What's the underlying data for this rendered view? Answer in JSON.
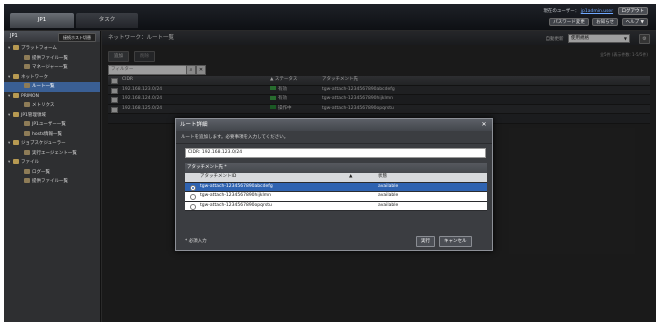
{
  "top_tabs": [
    "JP1",
    "タスク"
  ],
  "user": {
    "prefix": "現在のユーザー：",
    "name": "jp1admin.user",
    "logout": "ログアウト"
  },
  "util_buttons": [
    "パスワード変更",
    "お知らせ",
    "ヘルプ ▼"
  ],
  "sidebar": {
    "title": "JP1",
    "action_button": "接続ホスト切替",
    "items": [
      {
        "label": "プラットフォーム",
        "level": 0,
        "type": "folder"
      },
      {
        "label": "提供ファイル一覧",
        "level": 2,
        "type": "leaf"
      },
      {
        "label": "マネージャー一覧",
        "level": 2,
        "type": "leaf"
      },
      {
        "label": "ネットワーク",
        "level": 0,
        "type": "folder"
      },
      {
        "label": "ルート一覧",
        "level": 2,
        "type": "leaf",
        "selected": true
      },
      {
        "label": "PRIMON",
        "level": 0,
        "type": "folder"
      },
      {
        "label": "メトリクス",
        "level": 2,
        "type": "leaf"
      },
      {
        "label": "JP1管理領域",
        "level": 0,
        "type": "folder"
      },
      {
        "label": "JP1ユーザー一覧",
        "level": 2,
        "type": "leaf"
      },
      {
        "label": "hosts情報一覧",
        "level": 2,
        "type": "leaf"
      },
      {
        "label": "ジョブスケジューラー",
        "level": 0,
        "type": "folder"
      },
      {
        "label": "実行エージェント一覧",
        "level": 2,
        "type": "leaf"
      },
      {
        "label": "ファイル",
        "level": 0,
        "type": "folder"
      },
      {
        "label": "ログ一覧",
        "level": 2,
        "type": "leaf"
      },
      {
        "label": "提供ファイル一覧",
        "level": 2,
        "type": "leaf"
      }
    ]
  },
  "main": {
    "breadcrumb": "ネットワーク：ルート一覧",
    "display_label": "自動更新",
    "display_value": "使用規格",
    "sub_buttons": [
      "追加",
      "削除"
    ],
    "pager": "全5件 (表示件数: 1-5/5件)",
    "filter_placeholder": "フィルター",
    "columns": [
      "CIDR",
      "ステータス",
      "アタッチメント先"
    ],
    "rows": [
      {
        "cidr": "192.168.123.0/24",
        "status": "有効",
        "status_color": "#3fae4b",
        "attachment": "tgw-attach-1234567890abcdefg"
      },
      {
        "cidr": "192.168.124.0/24",
        "status": "有効",
        "status_color": "#3fae4b",
        "attachment": "tgw-attach-1234567890hijklmn"
      },
      {
        "cidr": "192.168.125.0/24",
        "status": "操作中",
        "status_color": "#2a8f3a",
        "attachment": "tgw-attach-1234567890opqrstu"
      }
    ]
  },
  "dialog": {
    "title": "ルート詳細",
    "description": "ルートを追加します。必要事項を入力してください。",
    "cidr_label": "CIDR:",
    "cidr_value": "192.168.123.0/24",
    "section_title": "アタッチメント先 *",
    "columns": [
      "アタッチメントID",
      "状態"
    ],
    "rows": [
      {
        "id": "tgw-attach-1234567890abcdefg",
        "state": "available",
        "selected": true
      },
      {
        "id": "tgw-attach-1234567890hijklmn",
        "state": "available",
        "selected": false
      },
      {
        "id": "tgw-attach-1234567890opqrstu",
        "state": "available",
        "selected": false
      }
    ],
    "required_note": "* 必須入力",
    "ok": "実行",
    "cancel": "キャンセル"
  }
}
